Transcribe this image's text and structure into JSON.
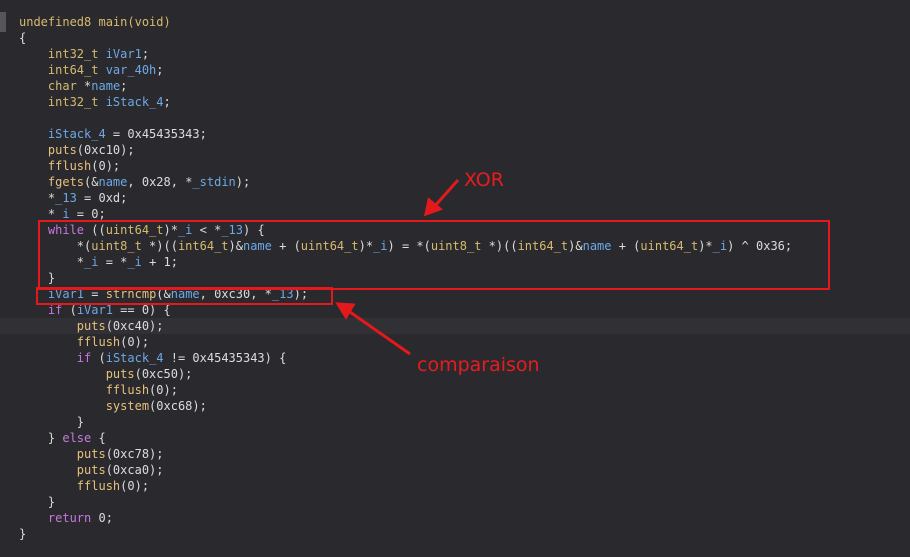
{
  "code_lines": [
    [
      {
        "t": "undefined8 main(void)",
        "c": "ty"
      }
    ],
    [
      {
        "t": "{",
        "c": "pl"
      }
    ],
    [
      {
        "t": "    int32_t ",
        "c": "ty"
      },
      {
        "t": "iVar1",
        "c": "var"
      },
      {
        "t": ";",
        "c": "pl"
      }
    ],
    [
      {
        "t": "    int64_t ",
        "c": "ty"
      },
      {
        "t": "var_40h",
        "c": "var"
      },
      {
        "t": ";",
        "c": "pl"
      }
    ],
    [
      {
        "t": "    char ",
        "c": "ty"
      },
      {
        "t": "*",
        "c": "op"
      },
      {
        "t": "name",
        "c": "var"
      },
      {
        "t": ";",
        "c": "pl"
      }
    ],
    [
      {
        "t": "    int32_t ",
        "c": "ty"
      },
      {
        "t": "iStack_4",
        "c": "var"
      },
      {
        "t": ";",
        "c": "pl"
      }
    ],
    [
      {
        "t": "",
        "c": "pl"
      }
    ],
    [
      {
        "t": "    ",
        "c": "pl"
      },
      {
        "t": "iStack_4",
        "c": "var"
      },
      {
        "t": " = 0x45435343;",
        "c": "pl"
      }
    ],
    [
      {
        "t": "    puts",
        "c": "fn"
      },
      {
        "t": "(0xc10);",
        "c": "pl"
      }
    ],
    [
      {
        "t": "    fflush",
        "c": "fn"
      },
      {
        "t": "(0);",
        "c": "pl"
      }
    ],
    [
      {
        "t": "    fgets",
        "c": "fn"
      },
      {
        "t": "(&",
        "c": "pl"
      },
      {
        "t": "name",
        "c": "var"
      },
      {
        "t": ", 0x28, *",
        "c": "pl"
      },
      {
        "t": "_stdin",
        "c": "var"
      },
      {
        "t": ");",
        "c": "pl"
      }
    ],
    [
      {
        "t": "    *",
        "c": "pl"
      },
      {
        "t": "_13",
        "c": "var"
      },
      {
        "t": " = 0xd;",
        "c": "pl"
      }
    ],
    [
      {
        "t": "    *",
        "c": "pl"
      },
      {
        "t": "_i",
        "c": "var"
      },
      {
        "t": " = 0;",
        "c": "pl"
      }
    ],
    [
      {
        "t": "    while ",
        "c": "kw"
      },
      {
        "t": "((",
        "c": "pl"
      },
      {
        "t": "uint64_t",
        "c": "ty"
      },
      {
        "t": ")*",
        "c": "pl"
      },
      {
        "t": "_i",
        "c": "var"
      },
      {
        "t": " < *",
        "c": "pl"
      },
      {
        "t": "_13",
        "c": "var"
      },
      {
        "t": ") {",
        "c": "pl"
      }
    ],
    [
      {
        "t": "        *(",
        "c": "pl"
      },
      {
        "t": "uint8_t",
        "c": "ty"
      },
      {
        "t": " *)((",
        "c": "pl"
      },
      {
        "t": "int64_t",
        "c": "ty"
      },
      {
        "t": ")&",
        "c": "pl"
      },
      {
        "t": "name",
        "c": "var"
      },
      {
        "t": " + (",
        "c": "pl"
      },
      {
        "t": "uint64_t",
        "c": "ty"
      },
      {
        "t": ")*",
        "c": "pl"
      },
      {
        "t": "_i",
        "c": "var"
      },
      {
        "t": ") = *(",
        "c": "pl"
      },
      {
        "t": "uint8_t",
        "c": "ty"
      },
      {
        "t": " *)((",
        "c": "pl"
      },
      {
        "t": "int64_t",
        "c": "ty"
      },
      {
        "t": ")&",
        "c": "pl"
      },
      {
        "t": "name",
        "c": "var"
      },
      {
        "t": " + (",
        "c": "pl"
      },
      {
        "t": "uint64_t",
        "c": "ty"
      },
      {
        "t": ")*",
        "c": "pl"
      },
      {
        "t": "_i",
        "c": "var"
      },
      {
        "t": ") ^ 0x36;",
        "c": "pl"
      }
    ],
    [
      {
        "t": "        *",
        "c": "pl"
      },
      {
        "t": "_i",
        "c": "var"
      },
      {
        "t": " = *",
        "c": "pl"
      },
      {
        "t": "_i",
        "c": "var"
      },
      {
        "t": " + 1;",
        "c": "pl"
      }
    ],
    [
      {
        "t": "    }",
        "c": "pl"
      }
    ],
    [
      {
        "t": "    ",
        "c": "pl"
      },
      {
        "t": "iVar1",
        "c": "var"
      },
      {
        "t": " = ",
        "c": "pl"
      },
      {
        "t": "strncmp",
        "c": "fn"
      },
      {
        "t": "(&",
        "c": "pl"
      },
      {
        "t": "name",
        "c": "var"
      },
      {
        "t": ", 0xc30, *",
        "c": "pl"
      },
      {
        "t": "_13",
        "c": "var"
      },
      {
        "t": ");",
        "c": "pl"
      }
    ],
    [
      {
        "t": "    if ",
        "c": "kw"
      },
      {
        "t": "(",
        "c": "pl"
      },
      {
        "t": "iVar1",
        "c": "var"
      },
      {
        "t": " == 0) {",
        "c": "pl"
      }
    ],
    [
      {
        "t": "        puts",
        "c": "fn"
      },
      {
        "t": "(0xc40);",
        "c": "pl"
      }
    ],
    [
      {
        "t": "        fflush",
        "c": "fn"
      },
      {
        "t": "(0);",
        "c": "pl"
      }
    ],
    [
      {
        "t": "        if ",
        "c": "kw"
      },
      {
        "t": "(",
        "c": "pl"
      },
      {
        "t": "iStack_4",
        "c": "var"
      },
      {
        "t": " != 0x45435343) {",
        "c": "pl"
      }
    ],
    [
      {
        "t": "            puts",
        "c": "fn"
      },
      {
        "t": "(0xc50);",
        "c": "pl"
      }
    ],
    [
      {
        "t": "            fflush",
        "c": "fn"
      },
      {
        "t": "(0);",
        "c": "pl"
      }
    ],
    [
      {
        "t": "            system",
        "c": "fn"
      },
      {
        "t": "(0xc68);",
        "c": "pl"
      }
    ],
    [
      {
        "t": "        }",
        "c": "pl"
      }
    ],
    [
      {
        "t": "    } ",
        "c": "pl"
      },
      {
        "t": "else",
        "c": "kw"
      },
      {
        "t": " {",
        "c": "pl"
      }
    ],
    [
      {
        "t": "        puts",
        "c": "fn"
      },
      {
        "t": "(0xc78);",
        "c": "pl"
      }
    ],
    [
      {
        "t": "        puts",
        "c": "fn"
      },
      {
        "t": "(0xca0);",
        "c": "pl"
      }
    ],
    [
      {
        "t": "        fflush",
        "c": "fn"
      },
      {
        "t": "(0);",
        "c": "pl"
      }
    ],
    [
      {
        "t": "    }",
        "c": "pl"
      }
    ],
    [
      {
        "t": "    return ",
        "c": "kw"
      },
      {
        "t": "0;",
        "c": "pl"
      }
    ],
    [
      {
        "t": "}",
        "c": "pl"
      }
    ]
  ],
  "current_line_index": 19,
  "annotations": {
    "xor_label": "XOR",
    "comparison_label": "comparaison"
  },
  "colors": {
    "background": "#2a2a2e",
    "annotation_red": "#e3191c",
    "keyword": "#c678dd",
    "type": "#d7ba6e",
    "variable": "#6ea8e6",
    "text": "#dcdcdc"
  }
}
